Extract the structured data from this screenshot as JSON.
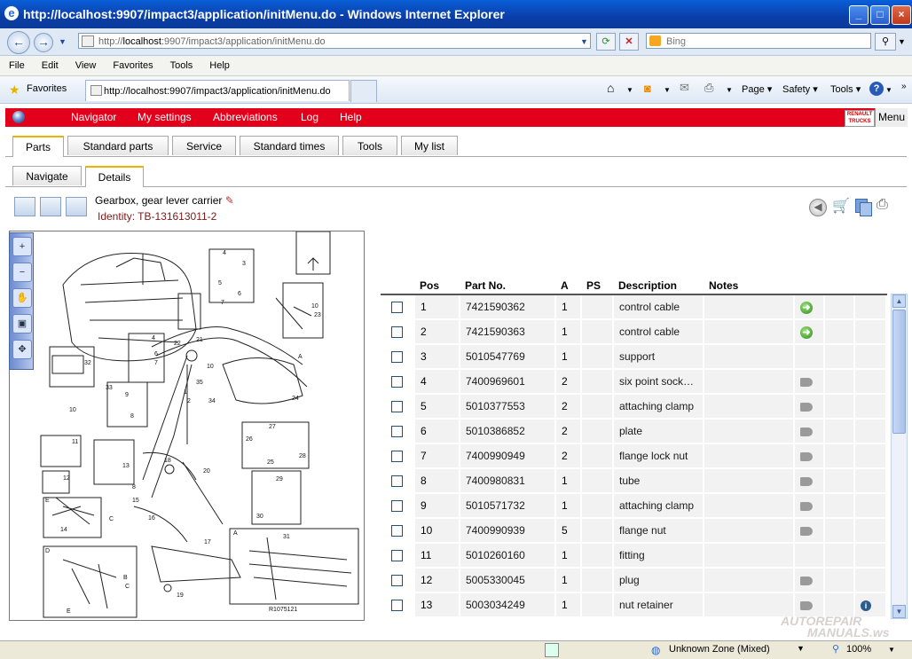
{
  "window": {
    "title": "http://localhost:9907/impact3/application/initMenu.do - Windows Internet Explorer"
  },
  "address": {
    "prefix": "http://",
    "host": "localhost",
    "rest": ":9907/impact3/application/initMenu.do"
  },
  "search": {
    "placeholder": "Bing"
  },
  "menubar": [
    "File",
    "Edit",
    "View",
    "Favorites",
    "Tools",
    "Help"
  ],
  "favorites": {
    "label": "Favorites",
    "tab_title": "http://localhost:9907/impact3/application/initMenu.do"
  },
  "commands": {
    "page": "Page",
    "safety": "Safety",
    "tools": "Tools"
  },
  "app_nav": [
    "Navigator",
    "My settings",
    "Abbreviations",
    "Log",
    "Help"
  ],
  "app_menu": "Menu",
  "logo_text": "RENAULT TRUCKS",
  "main_tabs": [
    "Parts",
    "Standard parts",
    "Service",
    "Standard times",
    "Tools",
    "My list"
  ],
  "sub_tabs": [
    "Navigate",
    "Details"
  ],
  "group": {
    "title": "Gearbox, gear lever carrier",
    "identity": "Identity: TB-131613011-2"
  },
  "illustration": {
    "reference": "R1075121"
  },
  "table": {
    "headers": [
      "",
      "Pos",
      "Part No.",
      "A",
      "PS",
      "Description",
      "Notes",
      "",
      "",
      ""
    ],
    "rows": [
      {
        "pos": "1",
        "part": "7421590362",
        "a": "1",
        "ps": "",
        "desc": "control cable",
        "notes": "",
        "icon": "arrow",
        "info": false
      },
      {
        "pos": "2",
        "part": "7421590363",
        "a": "1",
        "ps": "",
        "desc": "control cable",
        "notes": "",
        "icon": "arrow",
        "info": false
      },
      {
        "pos": "3",
        "part": "5010547769",
        "a": "1",
        "ps": "",
        "desc": "support",
        "notes": "",
        "icon": "",
        "info": false
      },
      {
        "pos": "4",
        "part": "7400969601",
        "a": "2",
        "ps": "",
        "desc": "six point sock…",
        "notes": "",
        "icon": "speaker",
        "info": false
      },
      {
        "pos": "5",
        "part": "5010377553",
        "a": "2",
        "ps": "",
        "desc": "attaching clamp",
        "notes": "",
        "icon": "speaker",
        "info": false
      },
      {
        "pos": "6",
        "part": "5010386852",
        "a": "2",
        "ps": "",
        "desc": "plate",
        "notes": "",
        "icon": "speaker",
        "info": false
      },
      {
        "pos": "7",
        "part": "7400990949",
        "a": "2",
        "ps": "",
        "desc": "flange lock nut",
        "notes": "",
        "icon": "speaker",
        "info": false
      },
      {
        "pos": "8",
        "part": "7400980831",
        "a": "1",
        "ps": "",
        "desc": "tube",
        "notes": "",
        "icon": "speaker",
        "info": false
      },
      {
        "pos": "9",
        "part": "5010571732",
        "a": "1",
        "ps": "",
        "desc": "attaching clamp",
        "notes": "",
        "icon": "speaker",
        "info": false
      },
      {
        "pos": "10",
        "part": "7400990939",
        "a": "5",
        "ps": "",
        "desc": "flange nut",
        "notes": "",
        "icon": "speaker",
        "info": false
      },
      {
        "pos": "11",
        "part": "5010260160",
        "a": "1",
        "ps": "",
        "desc": "fitting",
        "notes": "",
        "icon": "",
        "info": false
      },
      {
        "pos": "12",
        "part": "5005330045",
        "a": "1",
        "ps": "",
        "desc": "plug",
        "notes": "",
        "icon": "speaker",
        "info": false
      },
      {
        "pos": "13",
        "part": "5003034249",
        "a": "1",
        "ps": "",
        "desc": "nut retainer",
        "notes": "",
        "icon": "speaker",
        "info": true
      }
    ]
  },
  "status": {
    "zone": "Unknown Zone (Mixed)",
    "zoom": "100%"
  },
  "watermark": {
    "line1": "AUTOREPAIR",
    "line2": "MANUALS.ws"
  },
  "colors": {
    "brand_red": "#e3001b",
    "titlebar": "#0a4ec0",
    "active_tab_accent": "#f0b000"
  }
}
